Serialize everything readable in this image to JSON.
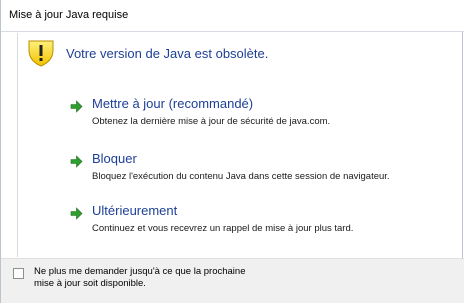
{
  "window": {
    "title": "Mise à jour Java requise"
  },
  "header": {
    "icon": "warning-icon",
    "message": "Votre version de Java est obsolète."
  },
  "options": [
    {
      "icon": "green-arrow-icon",
      "title": "Mettre à jour (recommandé)",
      "description": "Obtenez la dernière mise à jour de sécurité de java.com."
    },
    {
      "icon": "green-arrow-icon",
      "title": "Bloquer",
      "description": "Bloquez l'exécution du contenu Java dans cette session de navigateur."
    },
    {
      "icon": "green-arrow-icon",
      "title": "Ultérieurement",
      "description": "Continuez et vous recevrez un rappel de mise à jour plus tard."
    }
  ],
  "footer": {
    "checkbox_checked": false,
    "label_line1": "Ne plus me demander jusqu'à ce que la prochaine",
    "label_line2": "mise à jour soit disponible."
  },
  "colors": {
    "link_blue": "#1d3f96",
    "arrow_green": "#2e9e2e",
    "warning_yellow": "#f7d21c"
  }
}
